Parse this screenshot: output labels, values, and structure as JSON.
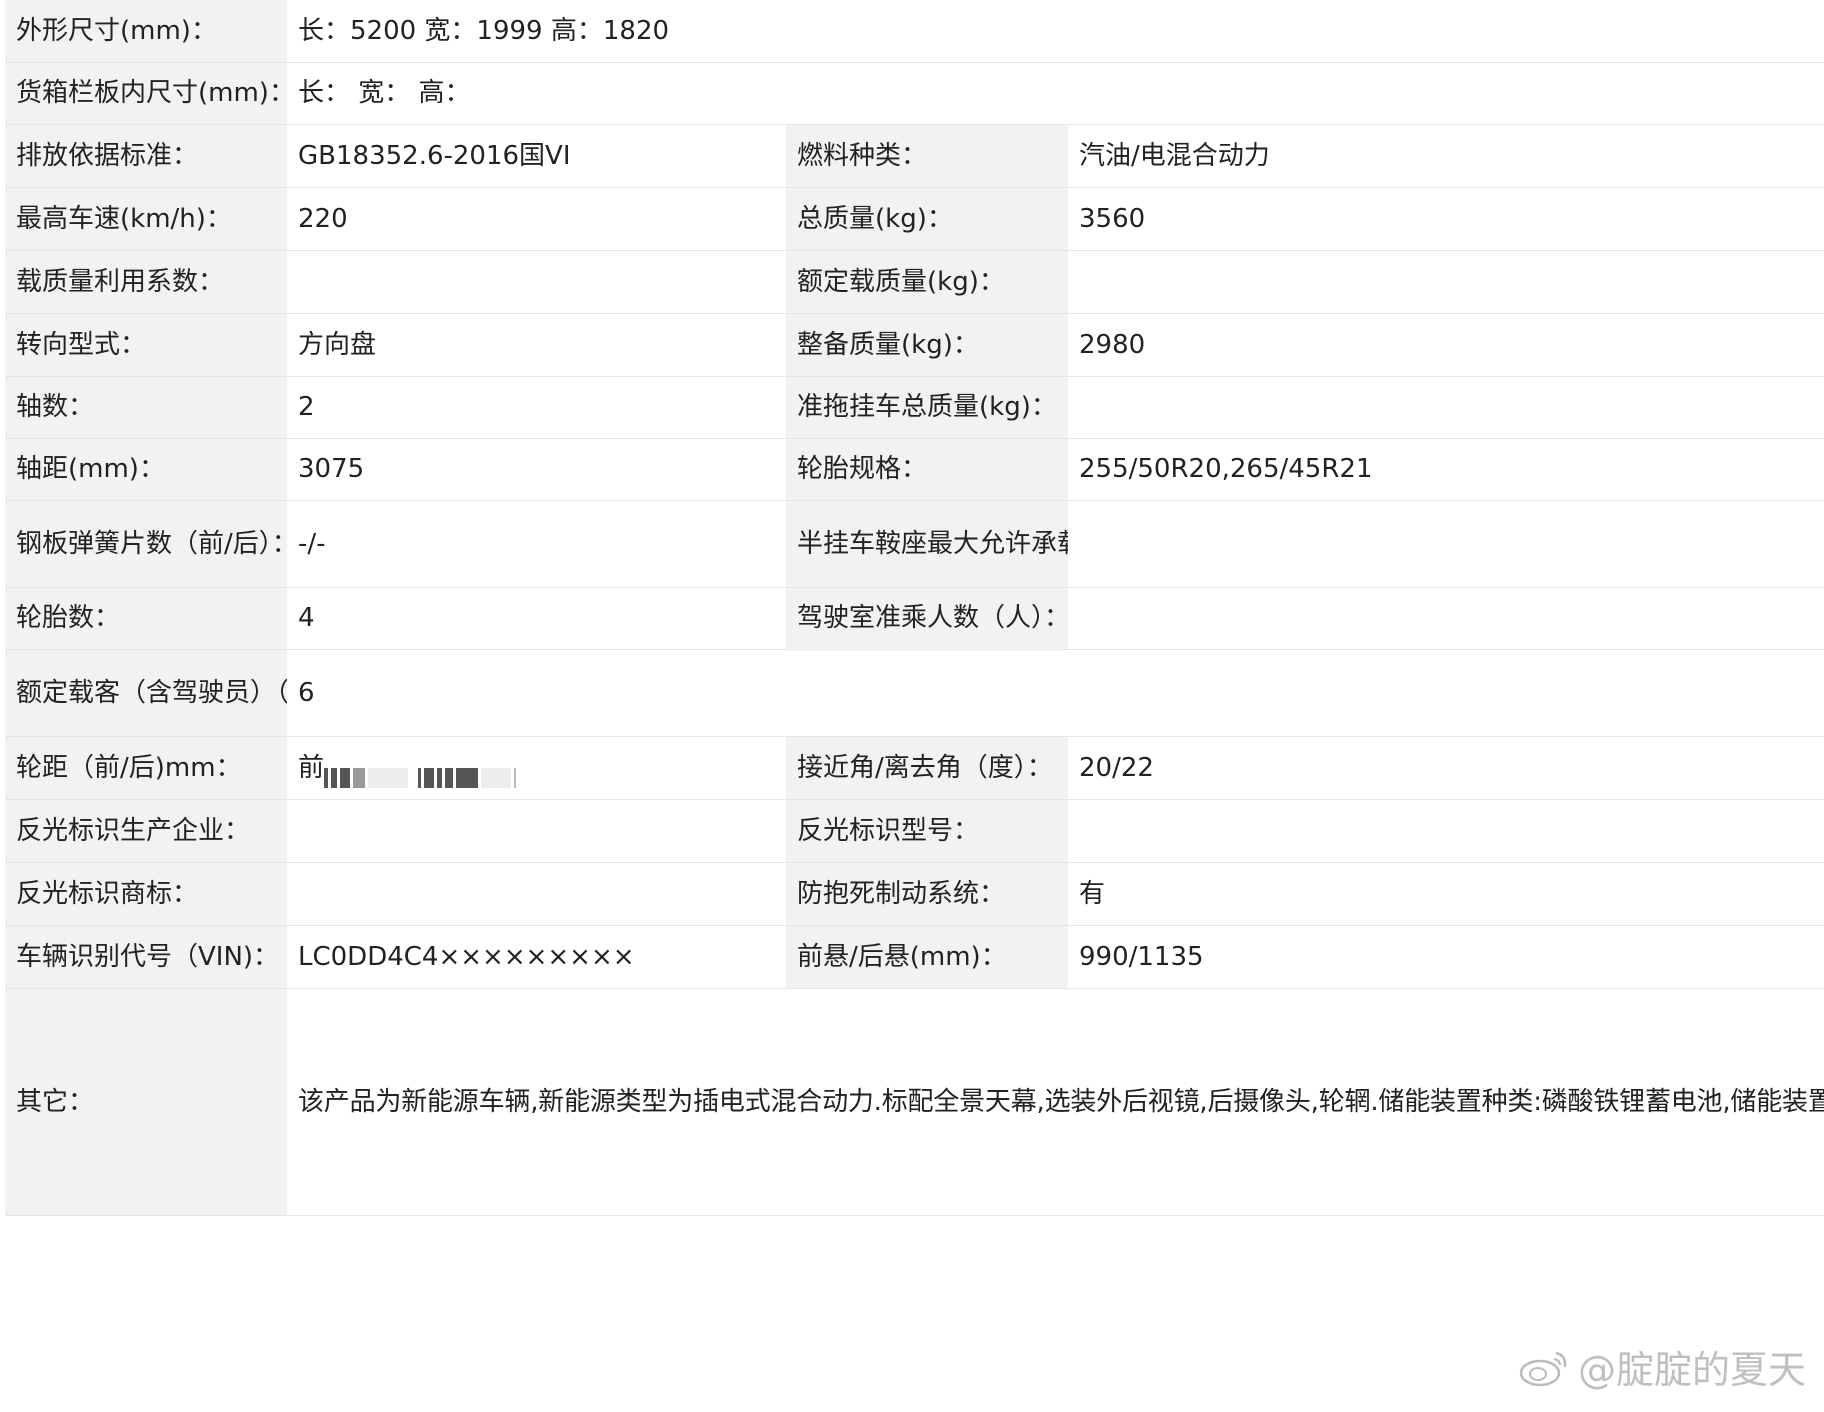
{
  "rows": {
    "r1": {
      "label": "外形尺寸(mm)：",
      "value": "长：5200 宽：1999 高：1820"
    },
    "r2": {
      "label": "货箱栏板内尺寸(mm)：",
      "value": "长：  宽：  高："
    },
    "r3": {
      "label": "排放依据标准：",
      "value": "GB18352.6-2016国VI",
      "label2": "燃料种类：",
      "value2": "汽油/电混合动力"
    },
    "r4": {
      "label": "最高车速(km/h)：",
      "value": "220",
      "label2": "总质量(kg)：",
      "value2": "3560"
    },
    "r5": {
      "label": "载质量利用系数：",
      "value": "",
      "label2": "额定载质量(kg)：",
      "value2": ""
    },
    "r6": {
      "label": "转向型式：",
      "value": "方向盘",
      "label2": "整备质量(kg)：",
      "value2": "2980"
    },
    "r7": {
      "label": "轴数：",
      "value": "2",
      "label2": "准拖挂车总质量(kg)：",
      "value2": ""
    },
    "r8": {
      "label": "轴距(mm)：",
      "value": "3075",
      "label2": "轮胎规格：",
      "value2": "255/50R20,265/45R21"
    },
    "r9": {
      "label": "钢板弹簧片数（前/后）：",
      "value": "-/-",
      "label2": "半挂车鞍座最大允许承载质量(kg)：",
      "value2": ""
    },
    "r10": {
      "label": "轮胎数：",
      "value": "4",
      "label2": "驾驶室准乘人数（人）：",
      "value2": ""
    },
    "r11": {
      "label": "额定载客（含驾驶员）（座位数）：",
      "value": "6"
    },
    "r12": {
      "label": "轮距（前/后)mm：",
      "value": "前",
      "label2": "接近角/离去角（度）：",
      "value2": "20/22"
    },
    "r13": {
      "label": "反光标识生产企业：",
      "value": "",
      "label2": "反光标识型号：",
      "value2": ""
    },
    "r14": {
      "label": "反光标识商标：",
      "value": "",
      "label2": "防抱死制动系统：",
      "value2": "有"
    },
    "r15": {
      "label": "车辆识别代号（VIN)：",
      "value": "LC0DD4C4×××××××××",
      "label2": "前悬/后悬(mm)：",
      "value2": "990/1135"
    },
    "r16": {
      "label": "其它：",
      "value": "该产品为新能源车辆,新能源类型为插电式混合动力.标配全景天幕,选装外后视镜,后摄像头,轮辋.储能装置种类:磷酸铁锂蓄电池,储能装置单体生产企业:西安弗迪电池有限公司,储能装置总成生产企业:济南弗迪电池有限公司.该车装配3电机,驱动电机类型:永磁同步电机,型号:前/后左/后右:TZ210XYD/TZ220XYBM/TZ220XYBM,生产企业:前/后左/后右:郑州比亚迪汽车有限公司/济南比亚迪汽车有限公司/济南比亚迪汽车有限公司,峰值功率:前/后左/后右:200kW/180kW/180kW,额定功率:前/后左/后右:90kW/50kW/50kW.ABS型号:IPB,IPB(FD),ABS生产企业:博世汽车部件(苏州)有限公司,弗迪动力有限公司.发动机最大净功率150kW.允许外接充电.该车型可选装ETC车载装置.该车配备汽车事件数据记录系统(EDR)."
    }
  },
  "watermark": {
    "text": "@腚腚的夏天",
    "icon": "weibo-logo-icon"
  }
}
